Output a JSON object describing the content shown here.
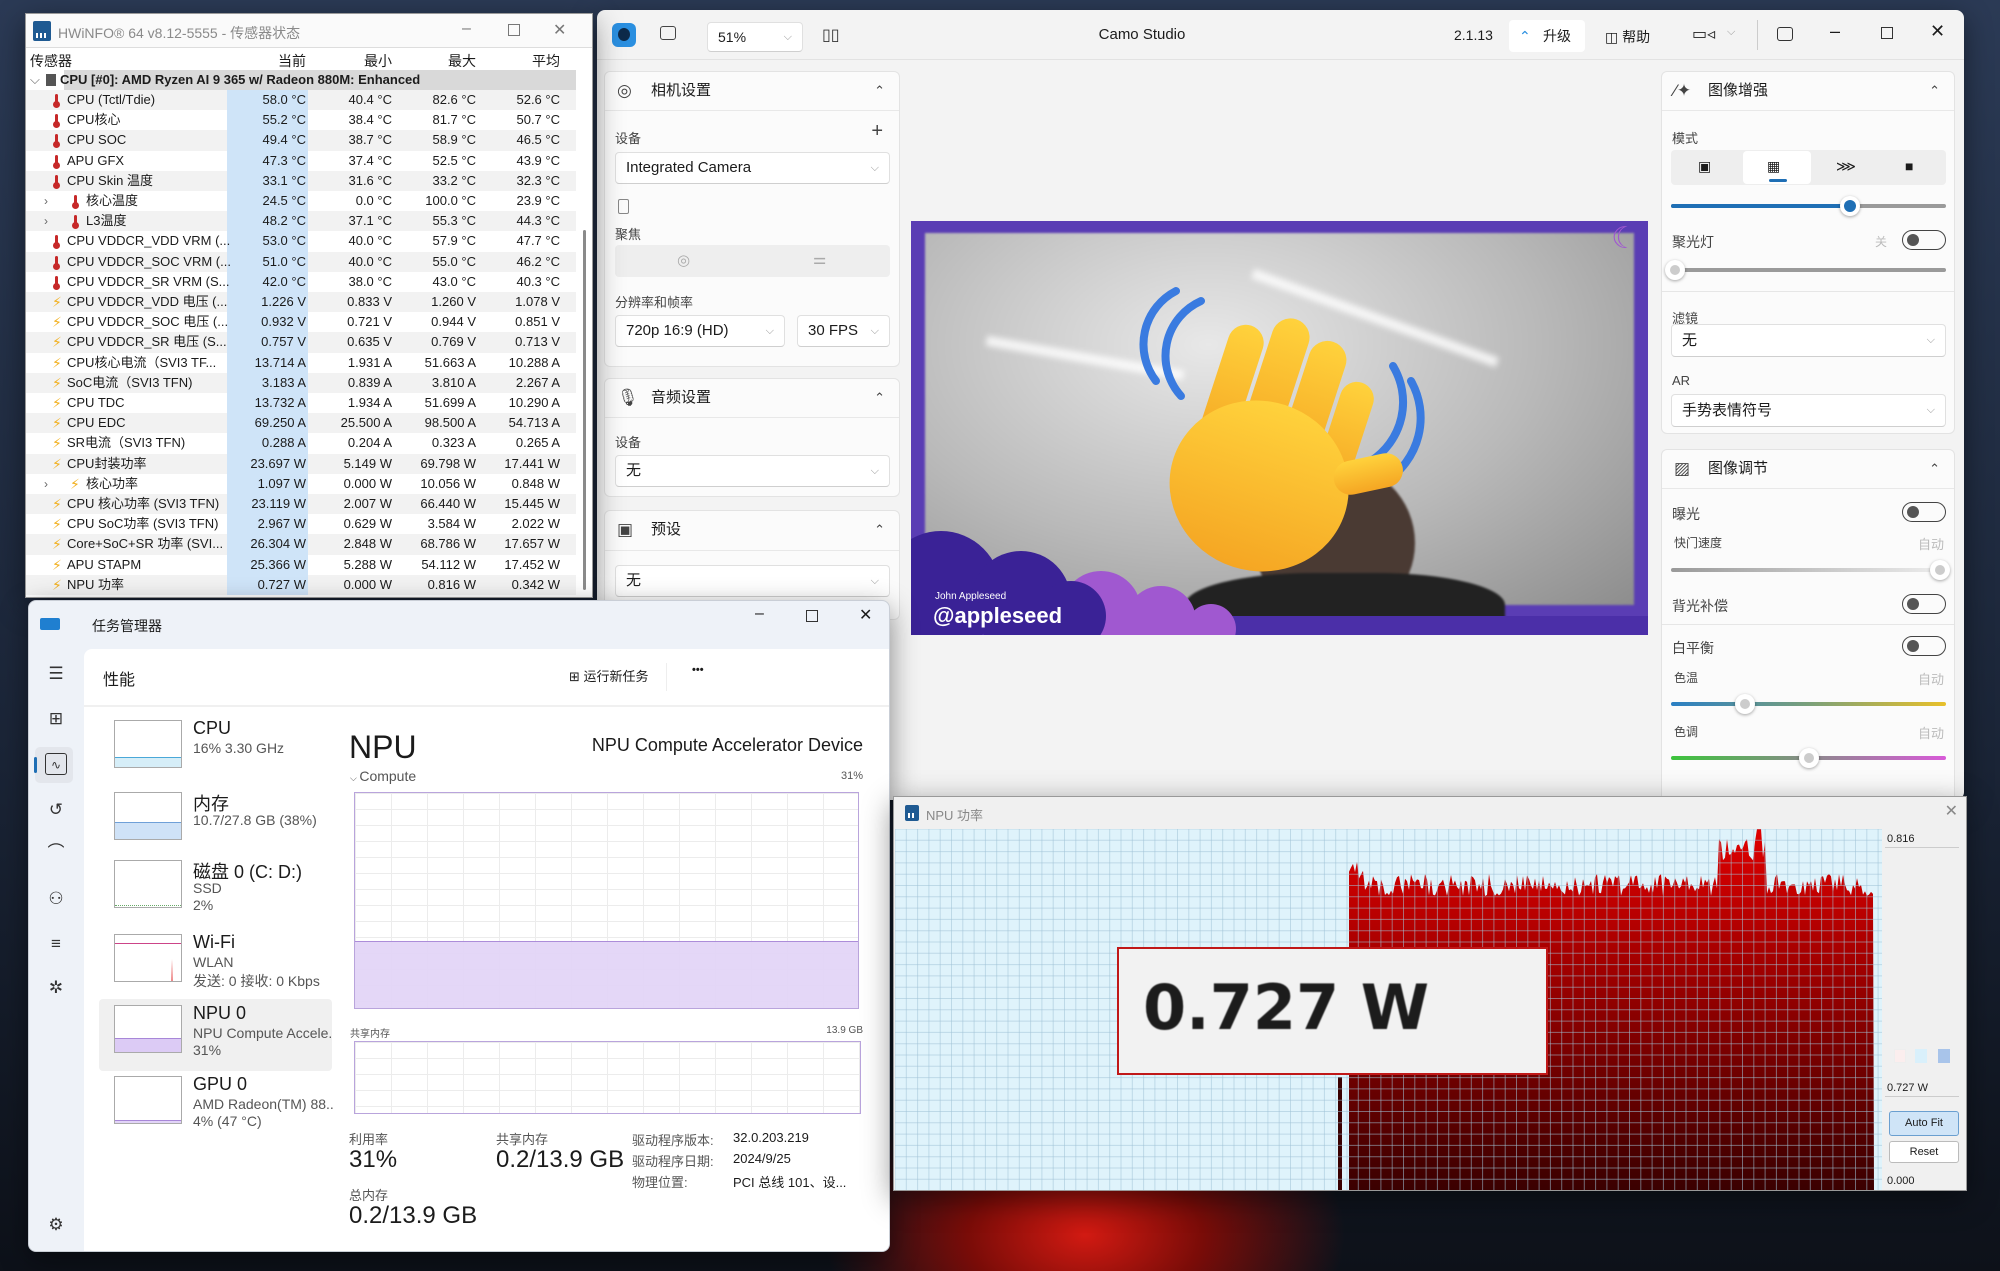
{
  "hwinfo": {
    "title": "HWiNFO® 64 v8.12-5555 - 传感器状态",
    "columns": {
      "sensor": "传感器",
      "current": "当前",
      "min": "最小",
      "max": "最大",
      "avg": "平均"
    },
    "group": "CPU [#0]: AMD Ryzen AI 9 365 w/ Radeon 880M: Enhanced",
    "rows": [
      {
        "name": "CPU (Tctl/Tdie)",
        "cur": "58.0 °C",
        "min": "40.4 °C",
        "max": "82.6 °C",
        "avg": "52.6 °C",
        "icon": "thermometer-icon"
      },
      {
        "name": "CPU核心",
        "cur": "55.2 °C",
        "min": "38.4 °C",
        "max": "81.7 °C",
        "avg": "50.7 °C",
        "icon": "thermometer-icon"
      },
      {
        "name": "CPU SOC",
        "cur": "49.4 °C",
        "min": "38.7 °C",
        "max": "58.9 °C",
        "avg": "46.5 °C",
        "icon": "thermometer-icon"
      },
      {
        "name": "APU GFX",
        "cur": "47.3 °C",
        "min": "37.4 °C",
        "max": "52.5 °C",
        "avg": "43.9 °C",
        "icon": "thermometer-icon"
      },
      {
        "name": "CPU Skin 温度",
        "cur": "33.1 °C",
        "min": "31.6 °C",
        "max": "33.2 °C",
        "avg": "32.3 °C",
        "icon": "thermometer-icon"
      },
      {
        "name": "核心温度",
        "cur": "24.5 °C",
        "min": "0.0 °C",
        "max": "100.0 °C",
        "avg": "23.9 °C",
        "icon": "thermometer-icon",
        "expandable": true
      },
      {
        "name": "L3温度",
        "cur": "48.2 °C",
        "min": "37.1 °C",
        "max": "55.3 °C",
        "avg": "44.3 °C",
        "icon": "thermometer-icon",
        "expandable": true
      },
      {
        "name": "CPU VDDCR_VDD VRM (...",
        "cur": "53.0 °C",
        "min": "40.0 °C",
        "max": "57.9 °C",
        "avg": "47.7 °C",
        "icon": "thermometer-icon"
      },
      {
        "name": "CPU VDDCR_SOC VRM (...",
        "cur": "51.0 °C",
        "min": "40.0 °C",
        "max": "55.0 °C",
        "avg": "46.2 °C",
        "icon": "thermometer-icon"
      },
      {
        "name": "CPU VDDCR_SR VRM (S...",
        "cur": "42.0 °C",
        "min": "38.0 °C",
        "max": "43.0 °C",
        "avg": "40.3 °C",
        "icon": "thermometer-icon"
      },
      {
        "name": "CPU VDDCR_VDD 电压 (...",
        "cur": "1.226 V",
        "min": "0.833 V",
        "max": "1.260 V",
        "avg": "1.078 V",
        "icon": "lightning-icon"
      },
      {
        "name": "CPU VDDCR_SOC 电压 (...",
        "cur": "0.932 V",
        "min": "0.721 V",
        "max": "0.944 V",
        "avg": "0.851 V",
        "icon": "lightning-icon"
      },
      {
        "name": "CPU VDDCR_SR 电压 (S...",
        "cur": "0.757 V",
        "min": "0.635 V",
        "max": "0.769 V",
        "avg": "0.713 V",
        "icon": "lightning-icon"
      },
      {
        "name": "CPU核心电流（SVI3 TF...",
        "cur": "13.714 A",
        "min": "1.931 A",
        "max": "51.663 A",
        "avg": "10.288 A",
        "icon": "lightning-icon"
      },
      {
        "name": "SoC电流（SVI3 TFN)",
        "cur": "3.183 A",
        "min": "0.839 A",
        "max": "3.810 A",
        "avg": "2.267 A",
        "icon": "lightning-icon"
      },
      {
        "name": "CPU TDC",
        "cur": "13.732 A",
        "min": "1.934 A",
        "max": "51.699 A",
        "avg": "10.290 A",
        "icon": "lightning-icon"
      },
      {
        "name": "CPU EDC",
        "cur": "69.250 A",
        "min": "25.500 A",
        "max": "98.500 A",
        "avg": "54.713 A",
        "icon": "lightning-icon"
      },
      {
        "name": "SR电流（SVI3 TFN)",
        "cur": "0.288 A",
        "min": "0.204 A",
        "max": "0.323 A",
        "avg": "0.265 A",
        "icon": "lightning-icon"
      },
      {
        "name": "CPU封装功率",
        "cur": "23.697 W",
        "min": "5.149 W",
        "max": "69.798 W",
        "avg": "17.441 W",
        "icon": "lightning-icon"
      },
      {
        "name": "核心功率",
        "cur": "1.097 W",
        "min": "0.000 W",
        "max": "10.056 W",
        "avg": "0.848 W",
        "icon": "lightning-icon",
        "expandable": true
      },
      {
        "name": "CPU 核心功率 (SVI3 TFN)",
        "cur": "23.119 W",
        "min": "2.007 W",
        "max": "66.440 W",
        "avg": "15.445 W",
        "icon": "lightning-icon"
      },
      {
        "name": "CPU SoC功率 (SVI3 TFN)",
        "cur": "2.967 W",
        "min": "0.629 W",
        "max": "3.584 W",
        "avg": "2.022 W",
        "icon": "lightning-icon"
      },
      {
        "name": "Core+SoC+SR 功率 (SVI...",
        "cur": "26.304 W",
        "min": "2.848 W",
        "max": "68.786 W",
        "avg": "17.657 W",
        "icon": "lightning-icon"
      },
      {
        "name": "APU STAPM",
        "cur": "25.366 W",
        "min": "5.288 W",
        "max": "54.112 W",
        "avg": "17.452 W",
        "icon": "lightning-icon"
      },
      {
        "name": "NPU 功率",
        "cur": "0.727 W",
        "min": "0.000 W",
        "max": "0.816 W",
        "avg": "0.342 W",
        "icon": "lightning-icon"
      }
    ]
  },
  "taskmgr": {
    "title": "任务管理器",
    "page": "性能",
    "run_new_task": "运行新任务",
    "more": "•••",
    "items": [
      {
        "name": "CPU",
        "lines": [
          "16%  3.30 GHz"
        ],
        "kind": "cpu"
      },
      {
        "name": "内存",
        "lines": [
          "10.7/27.8 GB (38%)"
        ],
        "kind": "mem",
        "fill": 38
      },
      {
        "name": "磁盘 0 (C: D:)",
        "lines": [
          "SSD",
          "2%"
        ],
        "kind": "disk"
      },
      {
        "name": "Wi-Fi",
        "lines": [
          "WLAN",
          "发送: 0 接收: 0 Kbps"
        ],
        "kind": "wifi"
      },
      {
        "name": "NPU 0",
        "lines": [
          "NPU Compute Accele.",
          "31%"
        ],
        "kind": "npu",
        "fill": 31,
        "selected": true
      },
      {
        "name": "GPU 0",
        "lines": [
          "AMD Radeon(TM) 88..",
          "4% (47 °C)"
        ],
        "kind": "gpu"
      }
    ],
    "detail": {
      "title": "NPU",
      "device": "NPU Compute Accelerator Device",
      "compute_label": "Compute",
      "compute_pct": "31%",
      "compute_value": 31,
      "shared_label": "共享内存",
      "shared_max": "13.9 GB",
      "util_label": "利用率",
      "util_value": "31%",
      "shared_mem_label": "共享内存",
      "shared_mem_value": "0.2/13.9 GB",
      "total_label": "总内存",
      "total_value": "0.2/13.9 GB",
      "driver_version_label": "驱动程序版本:",
      "driver_version": "32.0.203.219",
      "driver_date_label": "驱动程序日期:",
      "driver_date": "2024/9/25",
      "location_label": "物理位置:",
      "location": "PCI 总线 101、设..."
    }
  },
  "camo": {
    "title": "Camo Studio",
    "zoom": "51%",
    "version": "2.1.13",
    "upgrade": "升级",
    "help": "帮助",
    "camera": {
      "title": "相机设置",
      "device_label": "设备",
      "device": "Integrated Camera",
      "focus_label": "聚焦",
      "res_label": "分辨率和帧率",
      "resolution": "720p 16:9 (HD)",
      "fps": "30 FPS"
    },
    "audio": {
      "title": "音频设置",
      "device_label": "设备",
      "device": "无"
    },
    "preset": {
      "title": "预设",
      "value": "无"
    },
    "overlay": {
      "name": "John Appleseed",
      "handle": "@appleseed"
    },
    "enhance": {
      "title": "图像增强",
      "mode_label": "模式",
      "mode_selected": 1,
      "mode_level": 65,
      "spotlight_label": "聚光灯",
      "spotlight_state": "关",
      "spotlight_level": 0,
      "filter_label": "滤镜",
      "filter": "无",
      "ar_label": "AR",
      "ar": "手势表情符号"
    },
    "adjust": {
      "title": "图像调节",
      "exposure": "曝光",
      "shutter": "快门速度",
      "auto": "自动",
      "shutter_level": 100,
      "backlight": "背光补偿",
      "wb": "白平衡",
      "temp": "色温",
      "temp_level": 27,
      "tint": "色调",
      "tint_level": 50
    }
  },
  "npu_graph": {
    "title": "NPU 功率",
    "readout": "0.727 W",
    "max_label": "0.816",
    "current_label": "0.727 W",
    "min_label": "0.000",
    "auto_fit": "Auto Fit",
    "reset": "Reset",
    "ymax": 0.816,
    "ymin": 0,
    "idle_level": 0,
    "active_level": 0.72,
    "peak": 0.816,
    "fill_color": "#e00000",
    "bg_color": "#dff3fb"
  }
}
